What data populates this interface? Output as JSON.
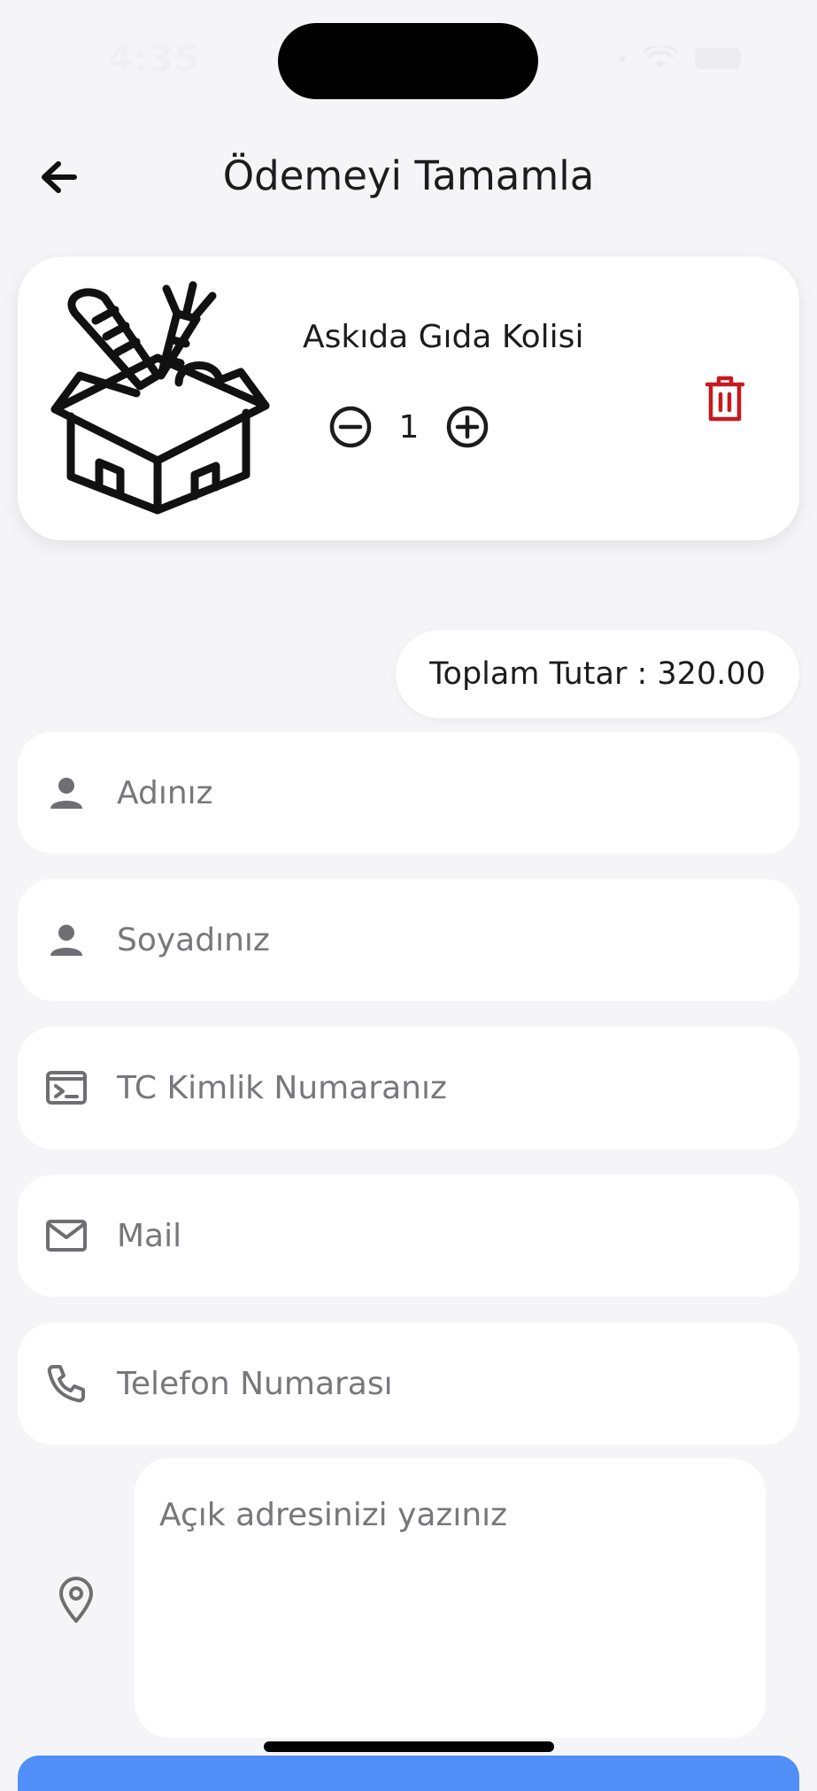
{
  "status_bar": {
    "time": "4:35"
  },
  "header": {
    "title": "Ödemeyi Tamamla",
    "back_icon": "arrow-left-icon"
  },
  "cart_item": {
    "name": "Askıda Gıda Kolisi",
    "quantity": "1",
    "image_icon": "grocery-box-icon",
    "minus_icon": "minus-circle-icon",
    "plus_icon": "plus-circle-icon",
    "delete_icon": "trash-icon",
    "delete_color": "#c8191e"
  },
  "total": {
    "text": "Toplam Tutar : 320.00"
  },
  "form": {
    "first_name": {
      "placeholder": "Adınız",
      "value": ""
    },
    "last_name": {
      "placeholder": "Soyadınız",
      "value": ""
    },
    "tc_id": {
      "placeholder": "TC Kimlik Numaranız",
      "value": ""
    },
    "mail": {
      "placeholder": "Mail",
      "value": ""
    },
    "phone": {
      "placeholder": "Telefon Numarası",
      "value": ""
    },
    "address": {
      "placeholder": "Açık adresinizi yazınız",
      "value": ""
    }
  },
  "colors": {
    "background": "#f5f5f7",
    "card": "#ffffff",
    "accent": "#4f8ff7",
    "icon_gray": "#6e6e73"
  }
}
